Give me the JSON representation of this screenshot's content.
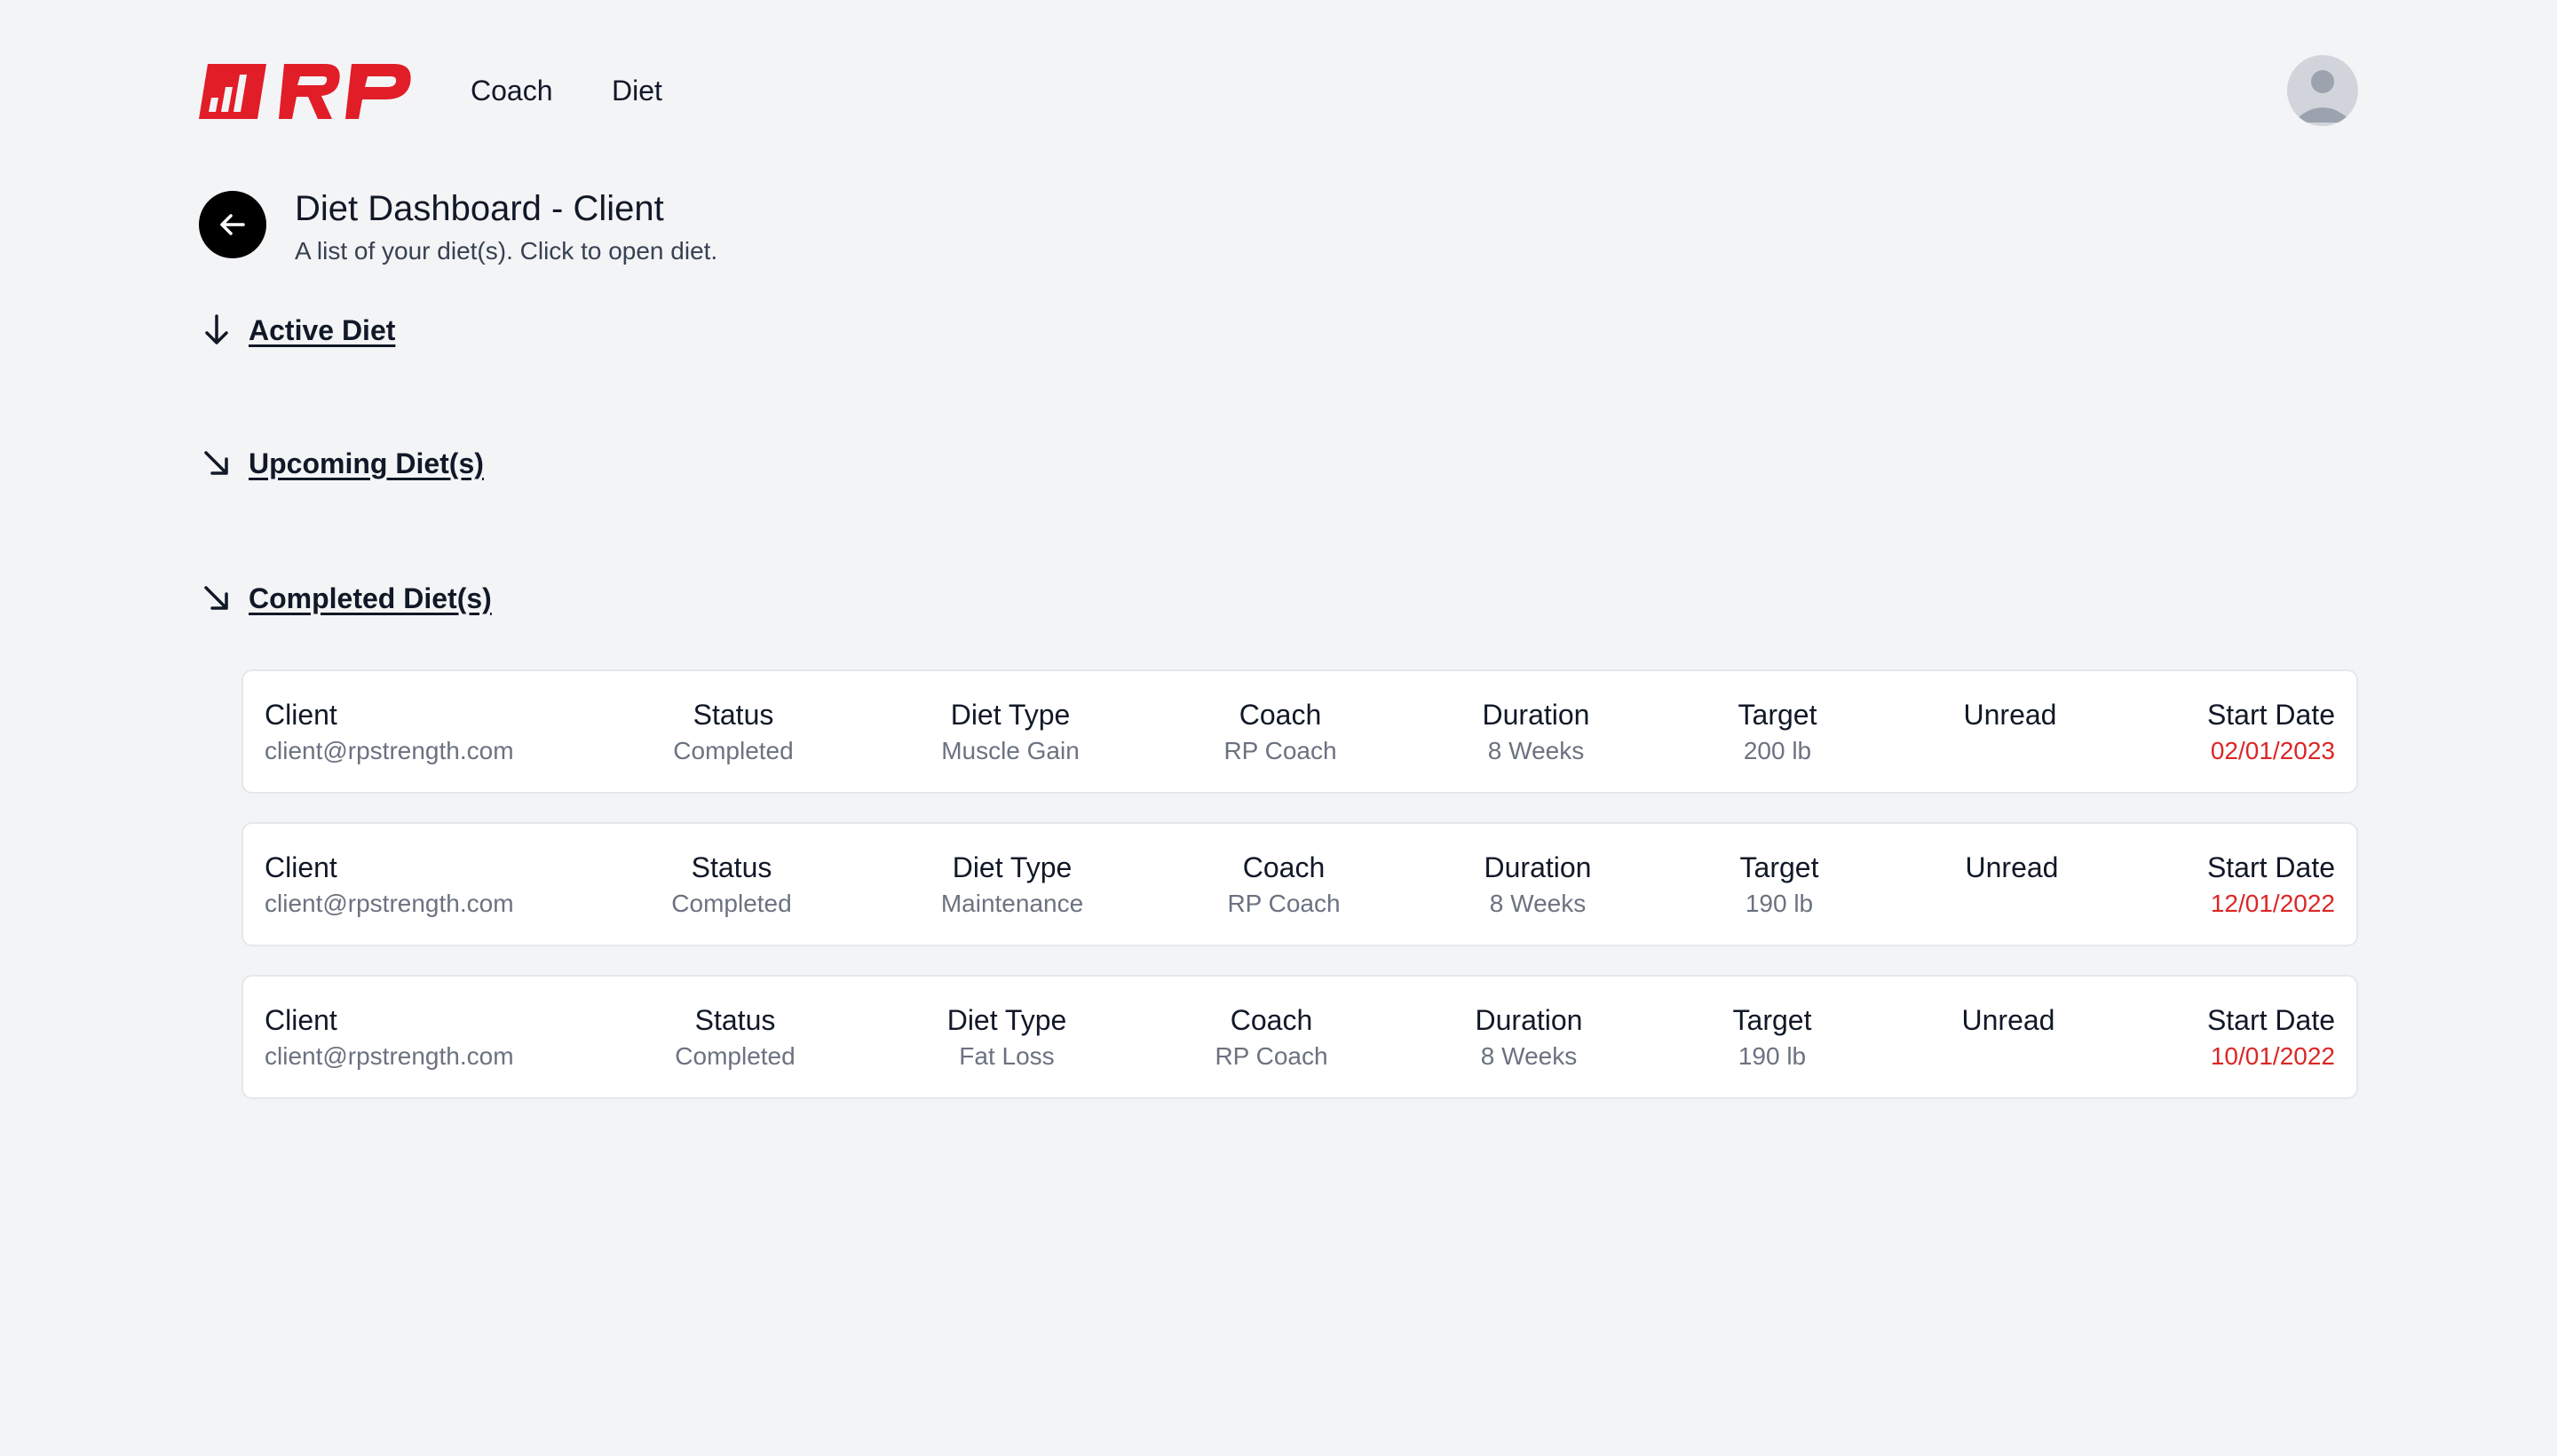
{
  "brand": {
    "logo_text": "RP",
    "accent_color": "#e11d28"
  },
  "nav": {
    "coach": "Coach",
    "diet": "Diet"
  },
  "header": {
    "title": "Diet Dashboard - Client",
    "subtitle": "A list of your diet(s). Click to open diet."
  },
  "sections": {
    "active": "Active Diet",
    "upcoming": "Upcoming Diet(s)",
    "completed": "Completed Diet(s)"
  },
  "columns": {
    "client": "Client",
    "status": "Status",
    "diet_type": "Diet Type",
    "coach": "Coach",
    "duration": "Duration",
    "target": "Target",
    "unread": "Unread",
    "start_date": "Start Date"
  },
  "diets": [
    {
      "client": "client@rpstrength.com",
      "status": "Completed",
      "diet_type": "Muscle Gain",
      "coach": "RP Coach",
      "duration": "8 Weeks",
      "target": "200 lb",
      "unread": "",
      "start_date": "02/01/2023"
    },
    {
      "client": "client@rpstrength.com",
      "status": "Completed",
      "diet_type": "Maintenance",
      "coach": "RP Coach",
      "duration": "8 Weeks",
      "target": "190 lb",
      "unread": "",
      "start_date": "12/01/2022"
    },
    {
      "client": "client@rpstrength.com",
      "status": "Completed",
      "diet_type": "Fat Loss",
      "coach": "RP Coach",
      "duration": "8 Weeks",
      "target": "190 lb",
      "unread": "",
      "start_date": "10/01/2022"
    }
  ],
  "icons": {
    "back": "arrow-left-icon",
    "active": "arrow-down-icon",
    "upcoming": "arrow-down-right-icon",
    "completed": "arrow-down-right-icon",
    "avatar": "user-avatar-icon"
  }
}
